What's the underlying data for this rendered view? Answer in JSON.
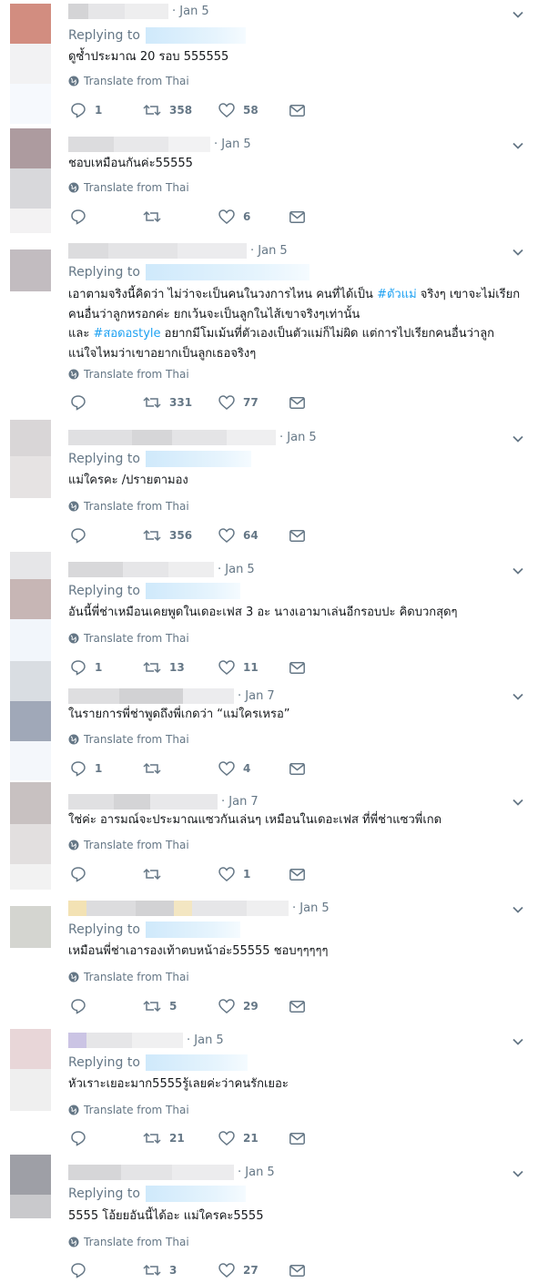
{
  "ui": {
    "replying_label": "Replying to",
    "translate_label": "Translate from Thai",
    "colors": {
      "secondary": "#657786",
      "hashtag": "#1da1f2",
      "divider": "#e6ecf0",
      "text": "#14171a"
    }
  },
  "tweets": [
    {
      "date": "· Jan 5",
      "replying": true,
      "lines": [
        "ดูซ้ำประมาณ 20 รอบ 555555"
      ],
      "replies": "1",
      "retweets": "358",
      "likes": "58"
    },
    {
      "date": "· Jan 5",
      "replying": false,
      "lines": [
        "ชอบเหมือนกันค่ะ55555"
      ],
      "replies": "",
      "retweets": "",
      "likes": "6"
    },
    {
      "date": "· Jan 5",
      "replying": true,
      "lines": [
        "เอาตามจริงนี้คิดว่า ไม่ว่าจะเป็นคนในวงการไหน คนที่ได้เป็น #ตัวแม่ จริงๆ เขาจะไม่เรียก",
        "คนอื่นว่าลูกหรอกค่ะ ยกเว้นจะเป็นลูกในไส้เขาจริงๆเท่านั้น",
        "และ #สอดอstyle อยากมีโมเม้นที่ตัวเองเป็นตัวแม่ก็ไม่ผิด แต่การไปเรียกคนอื่นว่าลูก",
        "แน่ใจไหมว่าเขาอยากเป็นลูกเธอจริงๆ"
      ],
      "replies": "",
      "retweets": "331",
      "likes": "77"
    },
    {
      "date": "· Jan 5",
      "replying": true,
      "lines": [
        "แม่ใครคะ /ปรายตามอง"
      ],
      "replies": "",
      "retweets": "356",
      "likes": "64"
    },
    {
      "date": "· Jan 5",
      "replying": true,
      "lines": [
        "อันนี้พี่ช่าเหมือนเคยพูดในเดอะเฟส 3 อะ นางเอามาเล่นอีกรอบปะ คิดบวกสุดๆ"
      ],
      "replies": "1",
      "retweets": "13",
      "likes": "11"
    },
    {
      "date": "· Jan 7",
      "replying": false,
      "lines": [
        "ในรายการพี่ช่าพูดถึงพี่เกดว่า “แม่ใครเหรอ”"
      ],
      "replies": "1",
      "retweets": "",
      "likes": "4"
    },
    {
      "date": "· Jan 7",
      "replying": false,
      "lines": [
        "ใช่ค่ะ อารมณ์จะประมาณแซวกันเล่นๆ เหมือนในเดอะเฟส ที่พี่ช่าแซวพี่เกด"
      ],
      "replies": "",
      "retweets": "",
      "likes": "1"
    },
    {
      "date": "· Jan 5",
      "replying": true,
      "lines": [
        "เหมือนพี่ช่าเอารองเท้าตบหน้าอ่ะ55555 ชอบๆๆๆๆๆ"
      ],
      "replies": "",
      "retweets": "5",
      "likes": "29"
    },
    {
      "date": "· Jan 5",
      "replying": true,
      "lines": [
        "หัวเราะเยอะมาก5555รู้เลยค่ะว่าคนรักเยอะ"
      ],
      "replies": "",
      "retweets": "21",
      "likes": "21"
    },
    {
      "date": "· Jan 5",
      "replying": true,
      "lines": [
        "5555 โอ้ยยอันนี้ได้อะ แม่ใครคะ5555"
      ],
      "replies": "",
      "retweets": "3",
      "likes": "27"
    }
  ]
}
